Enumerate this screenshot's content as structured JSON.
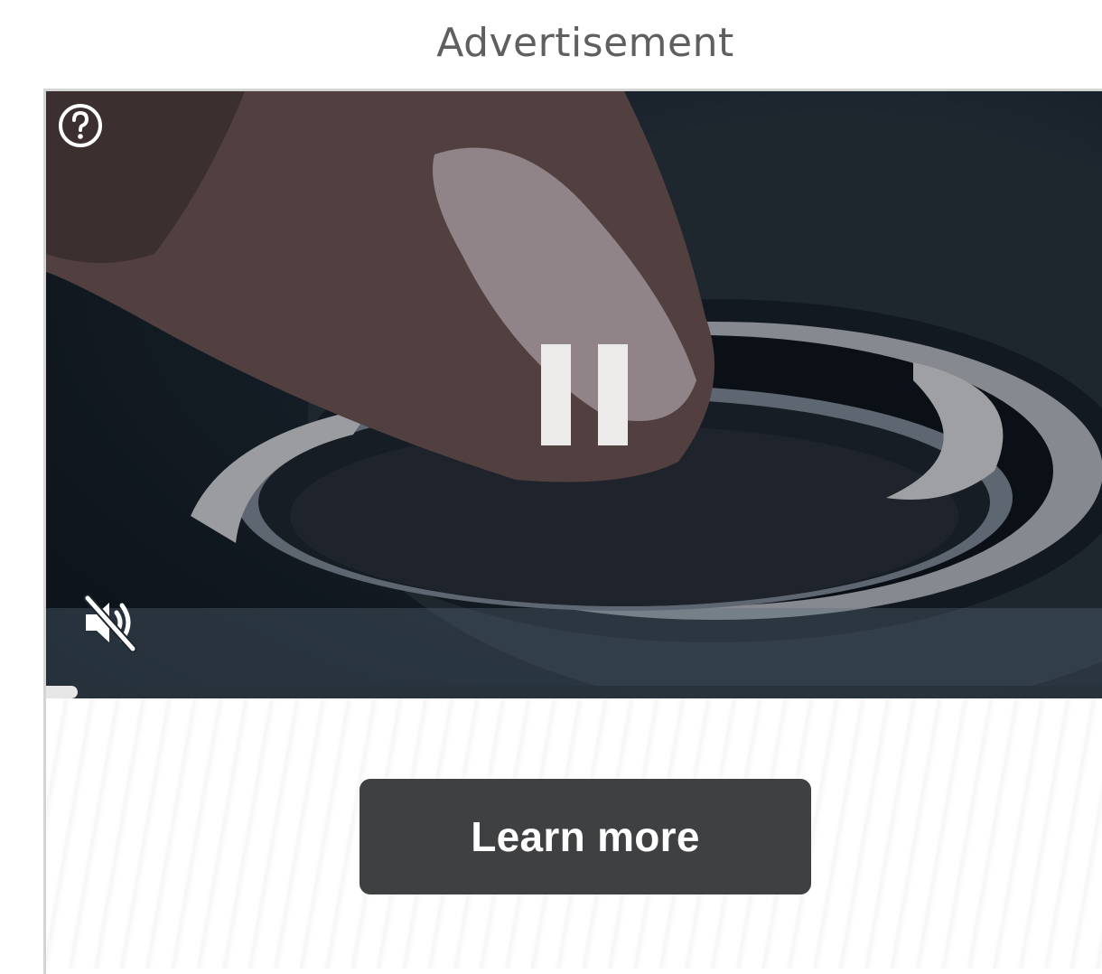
{
  "ad": {
    "label": "Advertisement",
    "cta_label": "Learn more",
    "accent_color": "#3f4042"
  },
  "player": {
    "help_icon": "question-circle-icon",
    "pause_icon": "pause-icon",
    "mute_icon": "volume-muted-icon",
    "state": "playing",
    "muted": true,
    "progress_fraction": 0.03
  }
}
